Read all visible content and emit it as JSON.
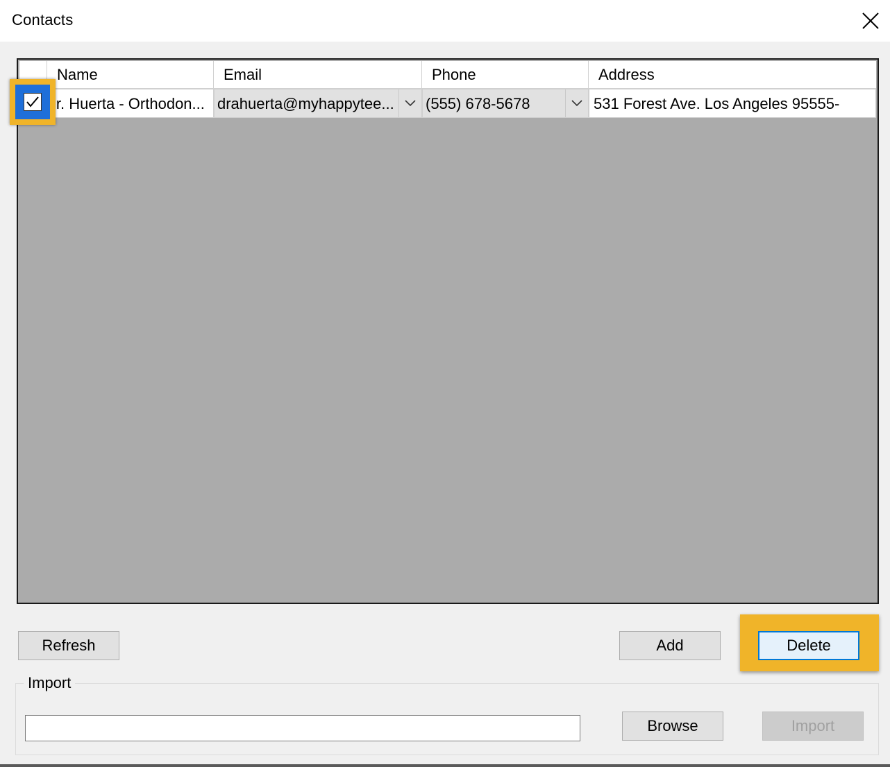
{
  "window": {
    "title": "Contacts"
  },
  "grid": {
    "columns": [
      "Name",
      "Email",
      "Phone",
      "Address"
    ],
    "rows": [
      {
        "checked": true,
        "name": "Dr. Huerta - Orthodon...",
        "email": "drahuerta@myhappytee...",
        "phone": "(555) 678-5678",
        "address": "531 Forest Ave. Los Angeles 95555-"
      }
    ]
  },
  "buttons": {
    "refresh": "Refresh",
    "add": "Add",
    "delete": "Delete",
    "browse": "Browse",
    "import": "Import"
  },
  "import_group": {
    "label": "Import",
    "path_value": ""
  },
  "colors": {
    "highlight": "#f0b429",
    "selection": "#1e6fd9",
    "grid_bg": "#ababab"
  }
}
